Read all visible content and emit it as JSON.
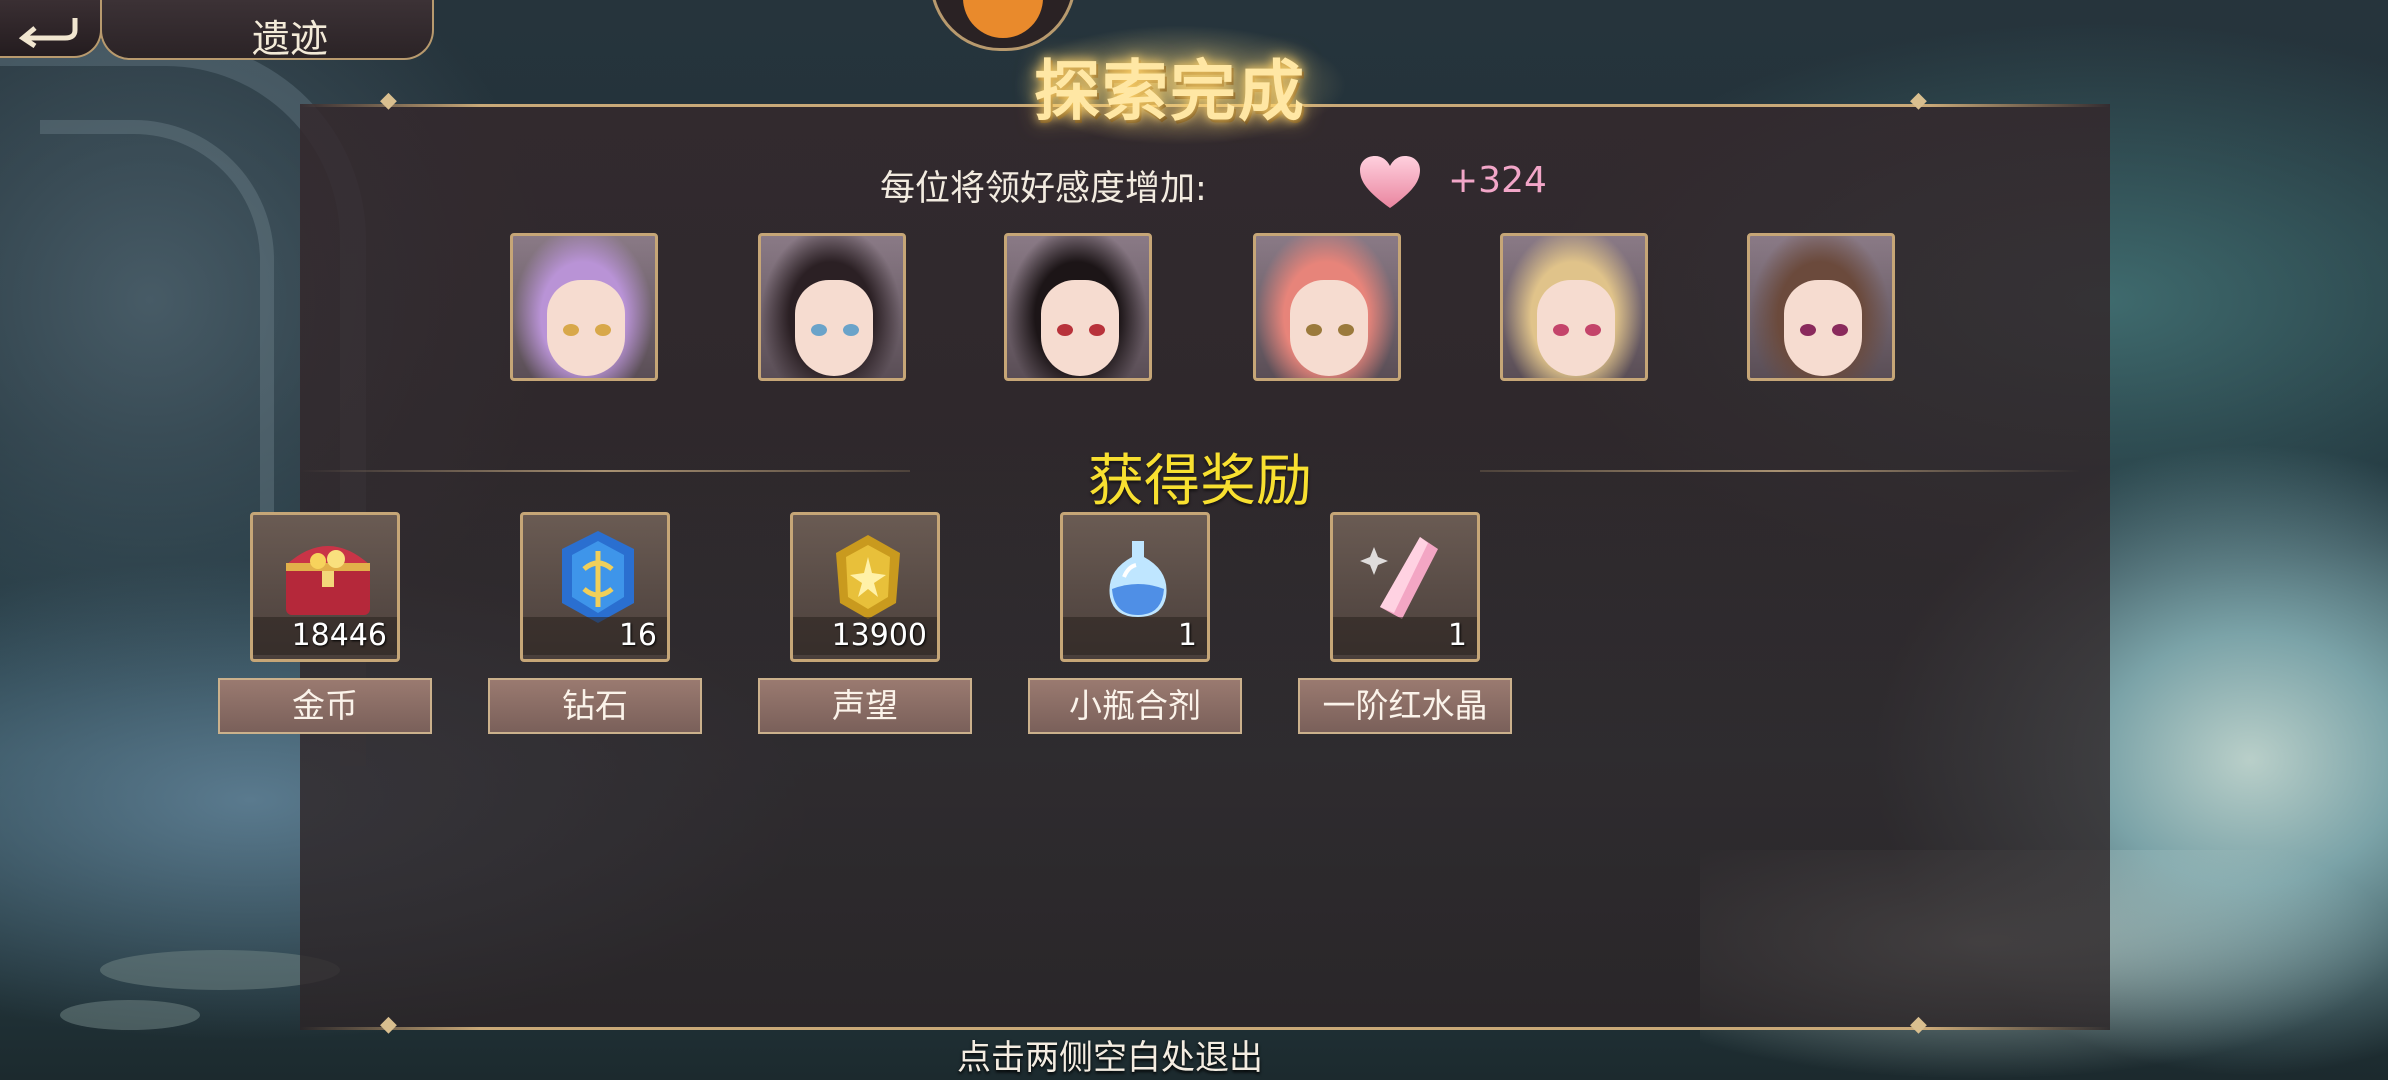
{
  "header": {
    "back_icon": "back-arrow-icon",
    "title": "遗迹"
  },
  "result": {
    "title": "探索完成",
    "favor_label": "每位将领好感度增加:",
    "favor_icon": "heart-icon",
    "favor_value": "+324"
  },
  "generals": [
    {
      "name": "general-1",
      "hair": "#b993d6",
      "eye": "#d8a84a"
    },
    {
      "name": "general-2",
      "hair": "#2b2024",
      "eye": "#6aa3c9"
    },
    {
      "name": "general-3",
      "hair": "#1c1517",
      "eye": "#b8323a"
    },
    {
      "name": "general-4",
      "hair": "#e7847a",
      "eye": "#9b7a3c"
    },
    {
      "name": "general-5",
      "hair": "#e0c38a",
      "eye": "#c4446a"
    },
    {
      "name": "general-6",
      "hair": "#6b4a3c",
      "eye": "#8a2a5c"
    }
  ],
  "rewards_section": {
    "title": "获得奖励",
    "items": [
      {
        "icon": "treasure-chest-icon",
        "count": "18446",
        "label": "金币"
      },
      {
        "icon": "diamond-crystal-icon",
        "count": "16",
        "label": "钻石"
      },
      {
        "icon": "gold-badge-icon",
        "count": "13900",
        "label": "声望"
      },
      {
        "icon": "potion-bottle-icon",
        "count": "1",
        "label": "小瓶合剂"
      },
      {
        "icon": "red-crystal-icon",
        "count": "1",
        "label": "一阶红水晶"
      }
    ]
  },
  "footer": {
    "exit_hint": "点击两侧空白处退出"
  },
  "colors": {
    "frame_gold": "#c6a677",
    "section_title": "#f8e030",
    "favor_value": "#f2a6c8"
  }
}
